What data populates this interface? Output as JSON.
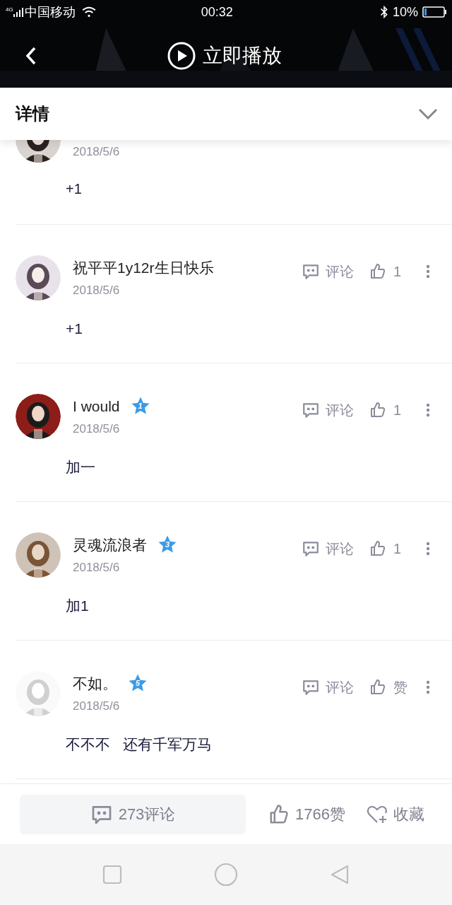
{
  "status_bar": {
    "network": "4G",
    "carrier": "中国移动",
    "time": "00:32",
    "battery": "10%"
  },
  "header": {
    "play_label": "立即播放"
  },
  "details_bar": {
    "title": "详情",
    "expanded": false
  },
  "comments": [
    {
      "kind": "partial",
      "date": "2018/5/6",
      "text": "+1"
    },
    {
      "kind": "full",
      "name": "祝平平1y12r生日快乐",
      "date": "2018/5/6",
      "text": "+1",
      "reply_label": "评论",
      "likes": "1"
    },
    {
      "kind": "full",
      "name": "I would",
      "badge": "1",
      "date": "2018/5/6",
      "text": "加一",
      "reply_label": "评论",
      "likes": "1"
    },
    {
      "kind": "full",
      "name": "灵魂流浪者",
      "badge": "3",
      "date": "2018/5/6",
      "text": "加1",
      "reply_label": "评论",
      "likes": "1"
    },
    {
      "kind": "full",
      "name": "不如。",
      "badge": "5",
      "date": "2018/5/6",
      "text": "不不不   还有千军万马",
      "reply_label": "评论",
      "likes": "赞"
    }
  ],
  "bottom_bar": {
    "comments": "273评论",
    "likes": "1766赞",
    "favorite": "收藏"
  }
}
